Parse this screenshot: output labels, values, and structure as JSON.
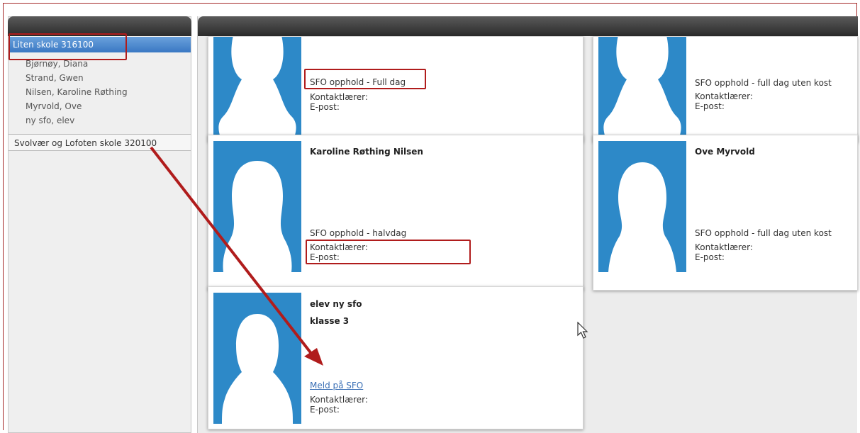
{
  "sidebar": {
    "active_school": "Liten skole 316100",
    "students": [
      "Bjørnøy, Diana",
      "Strand, Gwen",
      "Nilsen, Karoline Røthing",
      "Myrvold, Ove",
      "ny sfo, elev"
    ],
    "other_school": "Svolvær og Lofoten skole 320100"
  },
  "cards": [
    {
      "name": "",
      "care": "SFO opphold - Full dag",
      "teacher": "Kontaktlærer:",
      "email": "E-post:"
    },
    {
      "name": "",
      "care": "SFO opphold - full dag uten kost",
      "teacher": "Kontaktlærer:",
      "email": "E-post:"
    },
    {
      "name": "Karoline Røthing Nilsen",
      "care": "SFO opphold - halvdag",
      "teacher": "Kontaktlærer:",
      "email": "E-post:"
    },
    {
      "name": "Ove Myrvold",
      "care": "SFO opphold - full dag uten kost",
      "teacher": "Kontaktlærer:",
      "email": "E-post:"
    },
    {
      "name": "elev ny sfo",
      "class": "klasse 3",
      "link": "Meld på SFO",
      "teacher": "Kontaktlærer:",
      "email": "E-post:"
    }
  ],
  "colors": {
    "accent": "#2d89c8",
    "highlight": "#b01c1c",
    "active": "#3a78c3"
  },
  "icons": {
    "avatar": "person-silhouette-icon",
    "cursor": "mouse-pointer-icon",
    "annotation": "red-arrow"
  }
}
